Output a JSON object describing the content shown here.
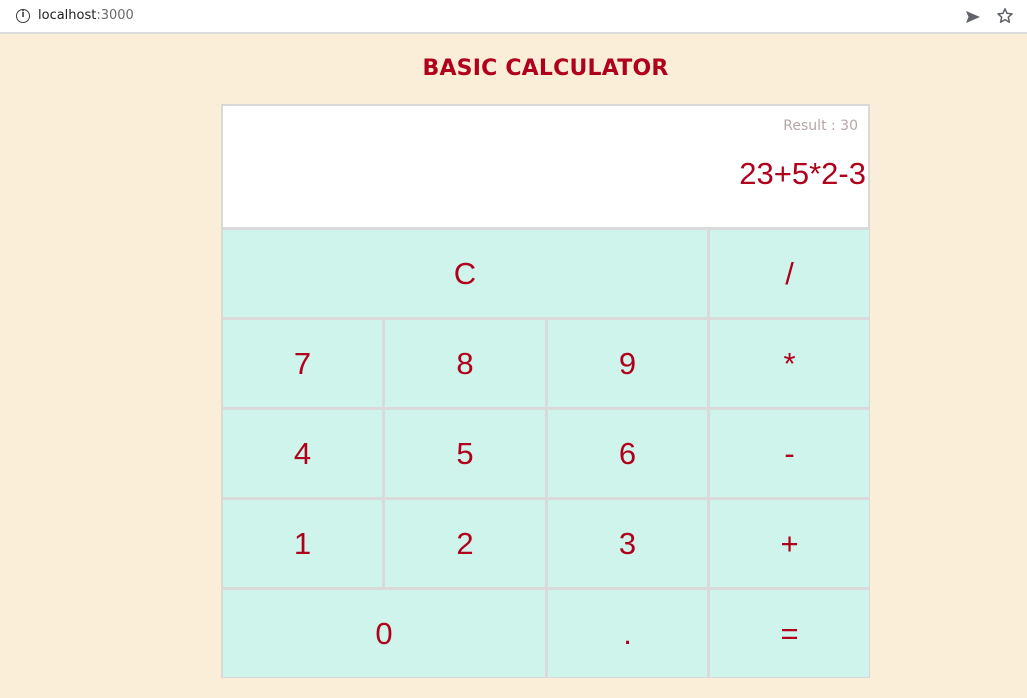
{
  "browser": {
    "url_host": "localhost",
    "url_port": ":3000"
  },
  "page": {
    "title": "BASIC CALCULATOR"
  },
  "display": {
    "result_text": "Result : 30",
    "expression": "23+5*2-3"
  },
  "keys": {
    "clear": "C",
    "divide": "/",
    "seven": "7",
    "eight": "8",
    "nine": "9",
    "multiply": "*",
    "four": "4",
    "five": "5",
    "six": "6",
    "subtract": "-",
    "one": "1",
    "two": "2",
    "three": "3",
    "add": "+",
    "zero": "0",
    "decimal": ".",
    "equals": "="
  },
  "colors": {
    "page_background": "#faeed9",
    "accent_red": "#b0001b",
    "key_background": "#cff4ec",
    "result_gray": "#b6a6a6"
  }
}
